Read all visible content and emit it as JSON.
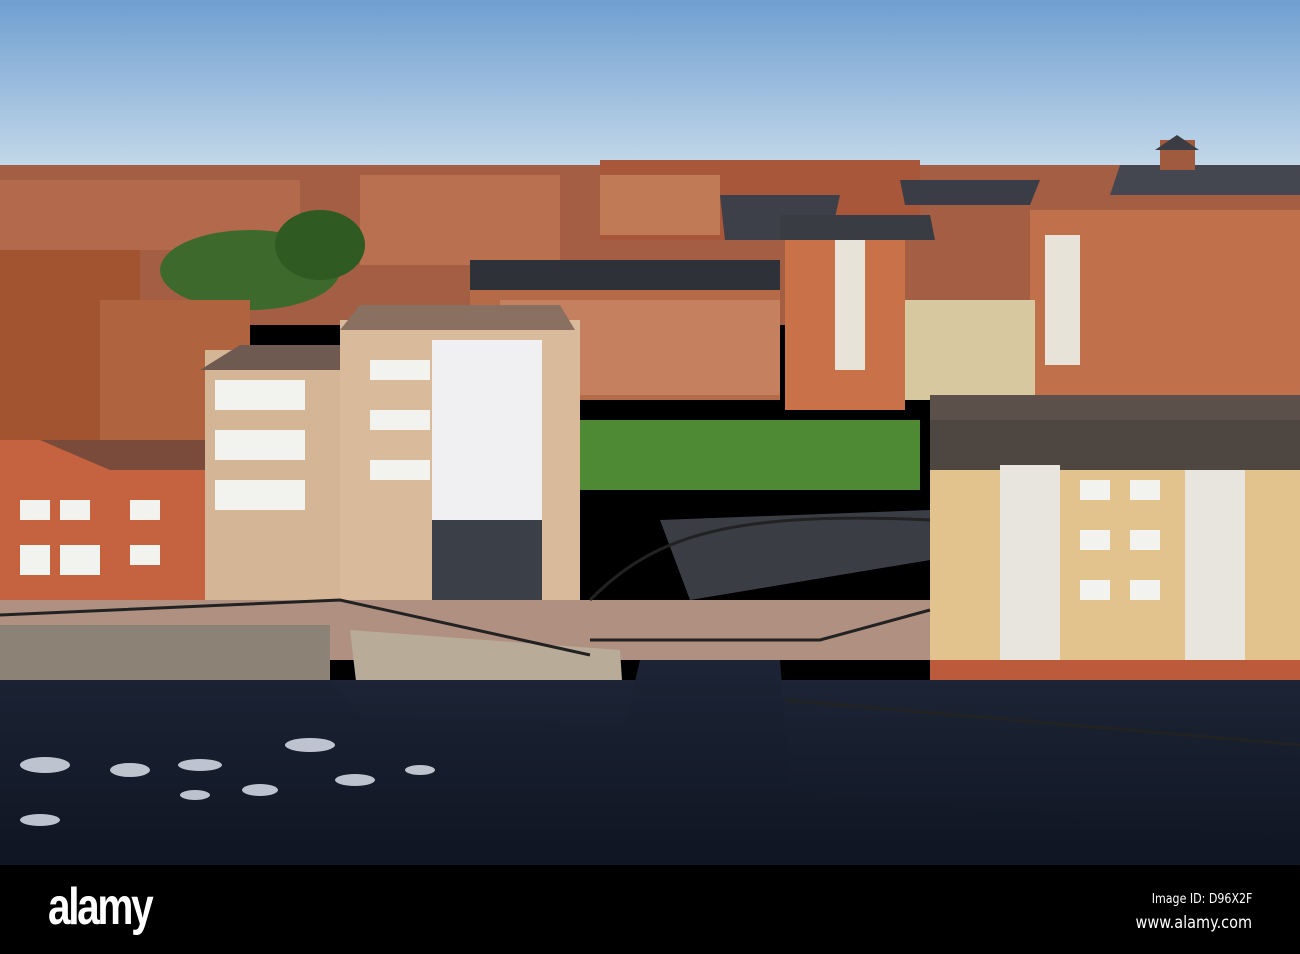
{
  "watermark": {
    "logo": "alamy",
    "image_id": "Image ID: D96X2F",
    "url": "www.alamy.com"
  },
  "colors": {
    "sky_top": "#6f9fd0",
    "sky_bottom": "#cfe0ec",
    "brick": "#b5633f",
    "water": "#141c2c",
    "bar": "#000000"
  }
}
